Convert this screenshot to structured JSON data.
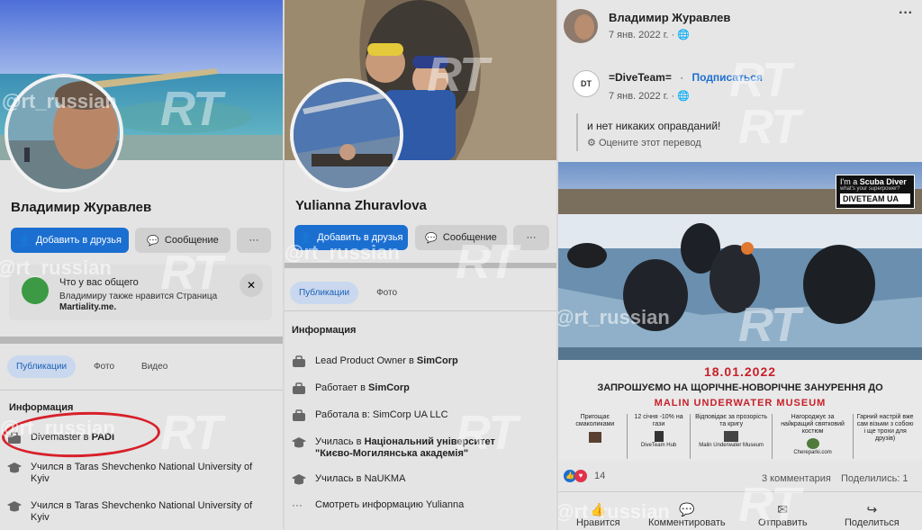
{
  "watermarks": {
    "handle": "@rt_russian",
    "logo": "RT"
  },
  "left": {
    "name": "Владимир Журавлев",
    "add_friend": "Добавить в друзья",
    "message": "Сообщение",
    "more": "···",
    "common": {
      "title": "Что у вас общего",
      "line1": "Владимиру также нравится Страница",
      "line2": "Martiality.me.",
      "close": "✕"
    },
    "tabs": [
      "Публикации",
      "Фото",
      "Видео"
    ],
    "info_title": "Информация",
    "info": [
      {
        "pre": "Divemaster в ",
        "strong": "PADI"
      },
      {
        "pre": "Учился в Taras Shevchenko National University of Kyiv",
        "strong": ""
      },
      {
        "pre": "Учился в Taras Shevchenko National University of Kyiv",
        "strong": ""
      }
    ]
  },
  "middle": {
    "name": "Yulianna Zhuravlova",
    "add_friend": "Добавить в друзья",
    "message": "Сообщение",
    "tabs": [
      "Публикации",
      "Фото"
    ],
    "info_title": "Информация",
    "info": [
      {
        "pre": "Lead Product Owner в ",
        "strong": "SimCorp"
      },
      {
        "pre": "Работает в ",
        "strong": "SimCorp"
      },
      {
        "pre": "Работала в: SimCorp UA LLC",
        "strong": ""
      },
      {
        "pre": "Училась в ",
        "strong": "Національний університет \"Києво-Могилянська академія\""
      },
      {
        "pre": "Училась в NaUKMA",
        "strong": ""
      },
      {
        "pre": "Смотреть информацию Yulianna",
        "strong": ""
      }
    ]
  },
  "right": {
    "author": "Владимир Журавлев",
    "date": "7 янв. 2022 г. · ",
    "more": "···",
    "shared_page": "=DiveTeam=",
    "dot": "·",
    "subscribe": "Подписаться",
    "shared_date": "7 янв. 2022 г. · ",
    "post_text": "и нет никаких оправданий!",
    "translate": "Оцените этот перевод",
    "photo_badge": {
      "line1a": "I'm a ",
      "line1b": "Scuba Diver",
      "line2": "what's your superpower?",
      "brand": "DIVETEAM UA"
    },
    "event_date": "18.01.2022",
    "event_heading": "ЗАПРОШУЄМО НА ЩОРІЧНЕ-НОВОРІЧНЕ ЗАНУРЕННЯ ДО",
    "event_place": "MALIN UNDERWATER MUSEUM",
    "columns": [
      {
        "text": "Пригощає смаколиками",
        "caption": ""
      },
      {
        "text": "12 січня -10% на гази",
        "caption": "DiveTeam Hub"
      },
      {
        "text": "Відповідає за прозорість та кригу",
        "caption": "Malin Underwater Museum"
      },
      {
        "text": "Нагороджує за найкращий святковий костюм",
        "caption": "Chereparki.com"
      },
      {
        "text": "Гарний настрій вже сам візьми з собою і ще трохи для друзів)",
        "caption": ""
      }
    ],
    "reactions_count": "14",
    "comments": "3 комментария",
    "shares": "Поделились: 1",
    "actions": [
      "Нравится",
      "Комментировать",
      "Отправить",
      "Поделиться"
    ]
  },
  "colors": {
    "accent": "#1b6fd1",
    "highlight_circle": "#d8202a",
    "event_red": "#c8202a"
  }
}
